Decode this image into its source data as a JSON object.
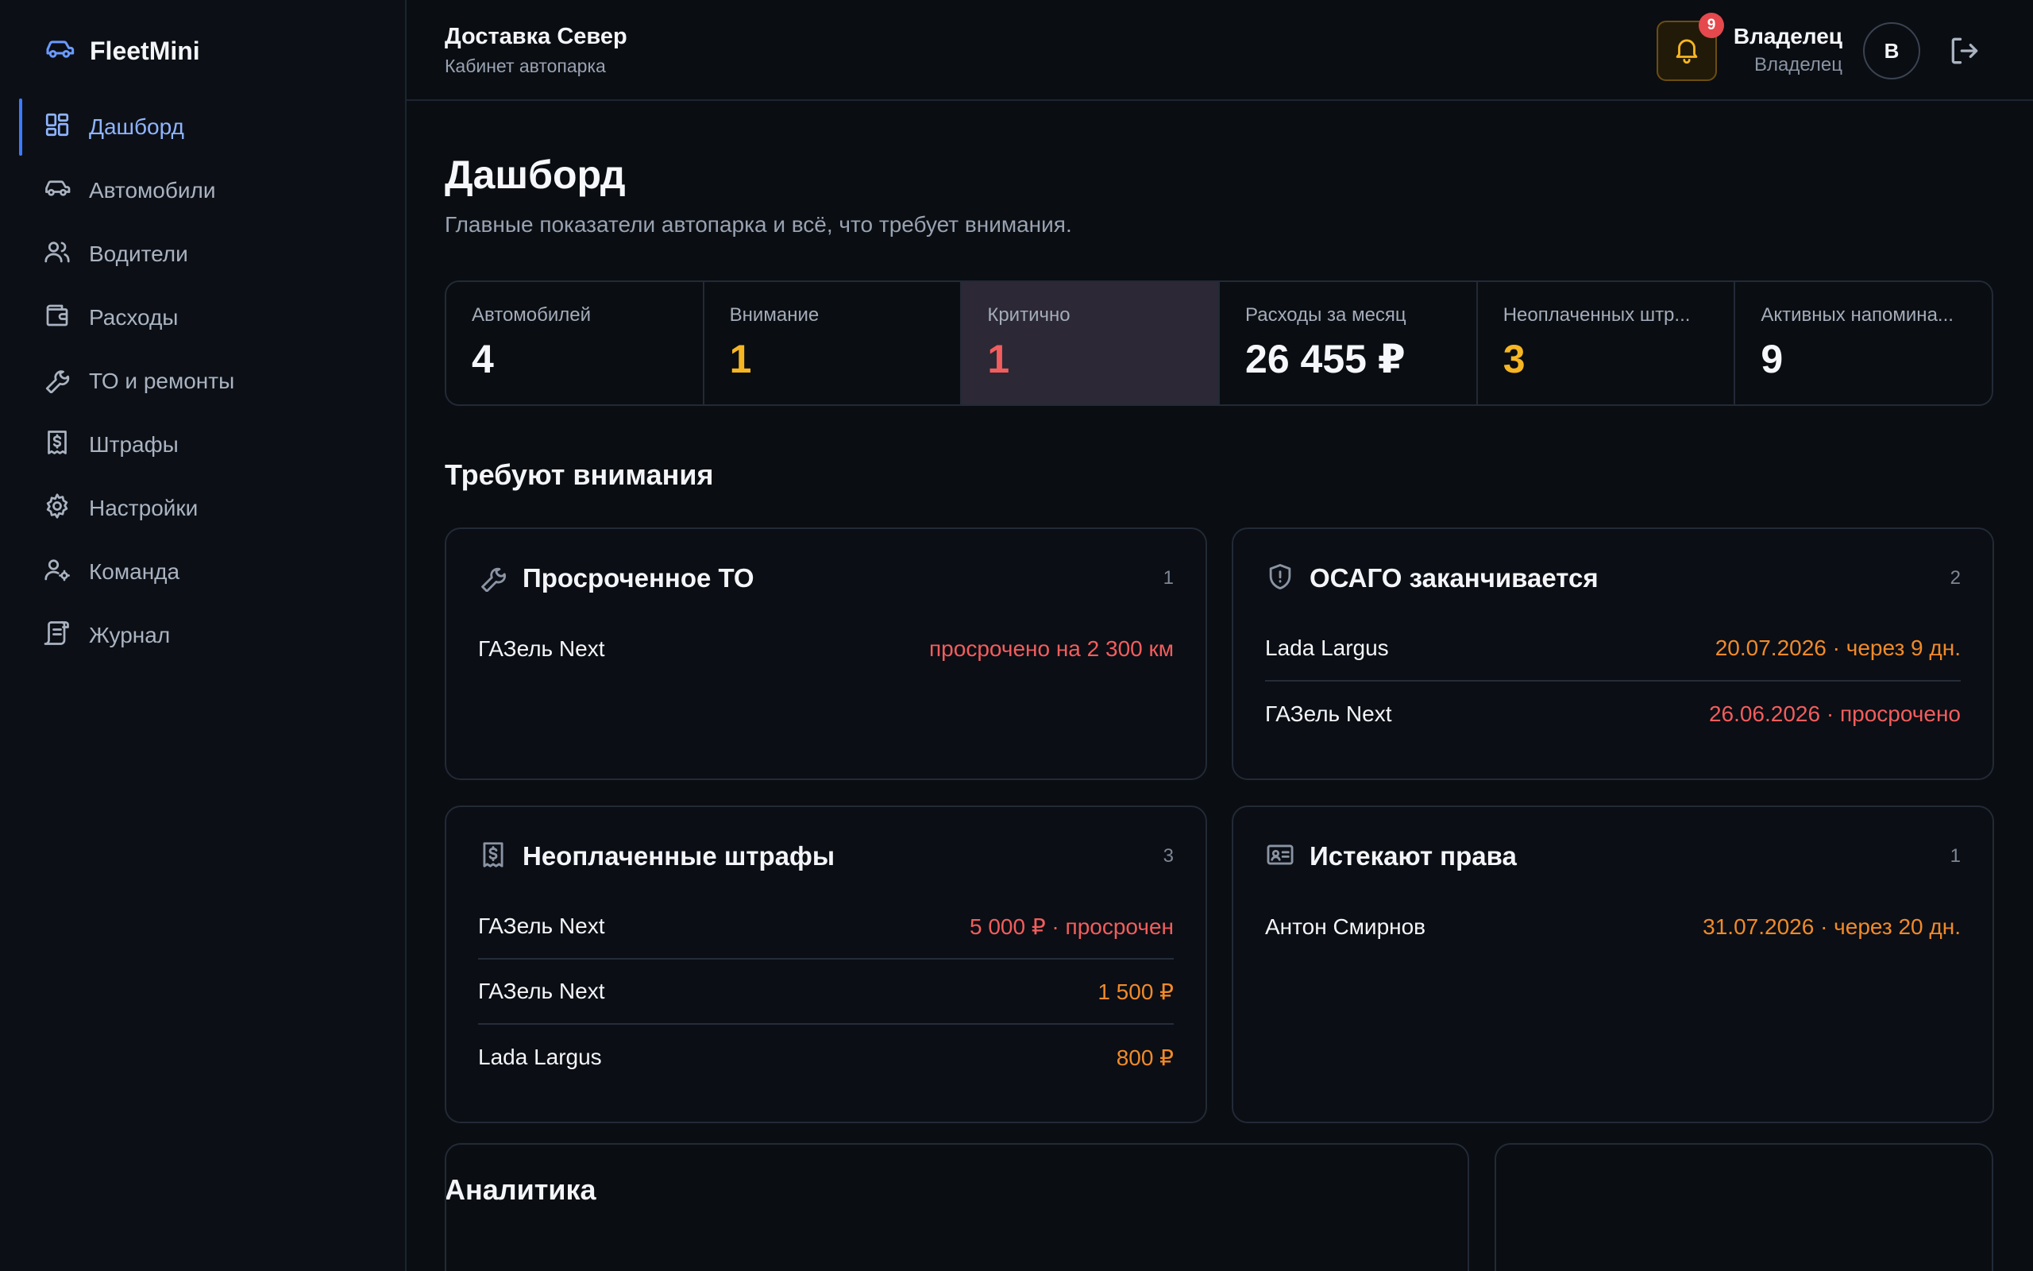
{
  "brand": {
    "name": "FleetMini"
  },
  "sidebar": {
    "items": [
      {
        "label": "Дашборд",
        "icon": "dashboard-icon"
      },
      {
        "label": "Автомобили",
        "icon": "car-icon"
      },
      {
        "label": "Водители",
        "icon": "users-icon"
      },
      {
        "label": "Расходы",
        "icon": "wallet-icon"
      },
      {
        "label": "ТО и ремонты",
        "icon": "wrench-icon"
      },
      {
        "label": "Штрафы",
        "icon": "receipt-icon"
      },
      {
        "label": "Настройки",
        "icon": "gear-icon"
      },
      {
        "label": "Команда",
        "icon": "user-gear-icon"
      },
      {
        "label": "Журнал",
        "icon": "scroll-icon"
      }
    ]
  },
  "header": {
    "org_name": "Доставка Север",
    "org_sub": "Кабинет автопарка",
    "notifications_count": "9",
    "user_name": "Владелец",
    "user_role": "Владелец",
    "avatar_letter": "В"
  },
  "page": {
    "title": "Дашборд",
    "subtitle": "Главные показатели автопарка и всё, что требует внимания."
  },
  "stats": [
    {
      "label": "Автомобилей",
      "value": "4"
    },
    {
      "label": "Внимание",
      "value": "1"
    },
    {
      "label": "Критично",
      "value": "1"
    },
    {
      "label": "Расходы за месяц",
      "value": "26 455 ₽"
    },
    {
      "label": "Неоплаченных штр...",
      "value": "3"
    },
    {
      "label": "Активных напомина...",
      "value": "9"
    }
  ],
  "attention": {
    "title": "Требуют внимания",
    "cards": [
      {
        "title": "Просроченное ТО",
        "count": "1",
        "icon": "wrench-icon",
        "rows": [
          {
            "name": "ГАЗель Next",
            "value": "просрочено на 2 300 км"
          }
        ]
      },
      {
        "title": "ОСАГО заканчивается",
        "count": "2",
        "icon": "shield-icon",
        "rows": [
          {
            "name": "Lada Largus",
            "value": "20.07.2026 · через 9 дн."
          },
          {
            "name": "ГАЗель Next",
            "value": "26.06.2026 · просрочено"
          }
        ]
      },
      {
        "title": "Неоплаченные штрафы",
        "count": "3",
        "icon": "receipt-icon",
        "rows": [
          {
            "name": "ГАЗель Next",
            "value": "5 000 ₽ · просрочен"
          },
          {
            "name": "ГАЗель Next",
            "value": "1 500 ₽"
          },
          {
            "name": "Lada Largus",
            "value": "800 ₽"
          }
        ]
      },
      {
        "title": "Истекают права",
        "count": "1",
        "icon": "id-card-icon",
        "rows": [
          {
            "name": "Антон Смирнов",
            "value": "31.07.2026 · через 20 дн."
          }
        ]
      }
    ]
  },
  "analytics": {
    "title": "Аналитика"
  },
  "colors": {
    "accent": "#3d7bff",
    "danger": "#f25d5d",
    "warning": "#f08a2a",
    "amber": "#f6b623"
  }
}
